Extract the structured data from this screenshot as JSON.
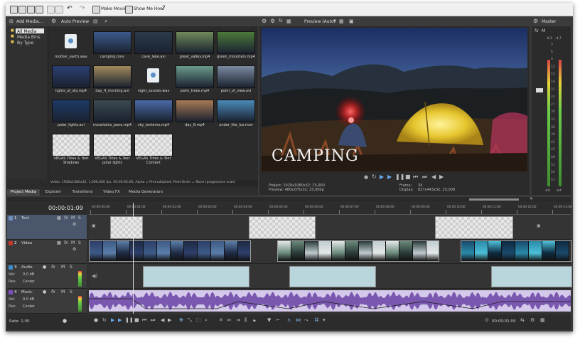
{
  "menubar": {
    "make_movie": "Make Movie",
    "show_me_how": "Show Me How"
  },
  "explorer": {
    "add_media": "Add Media...",
    "auto_preview": "Auto Preview",
    "tree": [
      "All Media",
      "Media Bins",
      "By Type"
    ],
    "items": [
      {
        "name": "mother_earth.wav",
        "kind": "audio"
      },
      {
        "name": "camping.mov",
        "kind": "video",
        "color": "#3b5a8a"
      },
      {
        "name": "cave_lake.avi",
        "kind": "video",
        "color": "#2c3b4a"
      },
      {
        "name": "great_valley.mp4",
        "kind": "video",
        "color": "#6f8a5a"
      },
      {
        "name": "green_mountain.mp4",
        "kind": "video",
        "color": "#4c7a3a"
      },
      {
        "name": "lights_of_sky.mp4",
        "kind": "video",
        "color": "#2a3f72"
      },
      {
        "name": "day_4_morning.avi",
        "kind": "video",
        "color": "#a08a5c"
      },
      {
        "name": "night_sounds.wav",
        "kind": "audio"
      },
      {
        "name": "palm_trees.mp4",
        "kind": "video",
        "color": "#6a9a8a"
      },
      {
        "name": "point_of_view.avi",
        "kind": "video",
        "color": "#7a8aa0"
      },
      {
        "name": "polar_lights.avi",
        "kind": "video",
        "color": "#1d3a66"
      },
      {
        "name": "mountains_pano.mp4",
        "kind": "video",
        "color": "#3c4a52"
      },
      {
        "name": "sky_lanterns.mp4",
        "kind": "video",
        "color": "#4a6aa8"
      },
      {
        "name": "day_6.mp4",
        "kind": "video",
        "color": "#a87a55"
      },
      {
        "name": "under_the_ice.mov",
        "kind": "video",
        "color": "#4a8ab8"
      },
      {
        "name": "VEGAS Titles & Text Shadows",
        "kind": "title"
      },
      {
        "name": "VEGAS Titles & Text polar lights",
        "kind": "title"
      },
      {
        "name": "VEGAS Titles & Text Content",
        "kind": "title"
      }
    ],
    "status": "Video: 1920x1080x32; 1,000,000 fps; 00:00:05:00; Alpha = Premultiplied; Field Order = None (progressive scan)",
    "tabs": [
      "Project Media",
      "Explorer",
      "Transitions",
      "Video FX",
      "Media Generators"
    ]
  },
  "preview": {
    "quality": "Preview (Auto)",
    "overlay_title": "CAMPING",
    "project": "Project:  1920x1080x32; 25,000",
    "preview_res": "Preview:  480x270x32; 25,000p",
    "frame_label": "Frame:",
    "frame_value": "34",
    "display_label": "Display:",
    "display_value": "827x443x32; 25,000"
  },
  "master": {
    "title": "Master",
    "scale": [
      "-4,3",
      "-4,7"
    ],
    "db_ticks": [
      "3",
      "6",
      "9",
      "12",
      "15",
      "18",
      "21",
      "24",
      "27",
      "30",
      "33",
      "36",
      "39",
      "42",
      "45",
      "48",
      "51",
      "54",
      "57"
    ],
    "bottom": [
      "-Inf.",
      "-Inf."
    ]
  },
  "timeline": {
    "timecode": "00:00:01:09",
    "ruler": [
      "00:00:00:00",
      "00:00:01:00",
      "00:00:02:00",
      "00:00:03:00",
      "00:00:04:00",
      "00:00:05:00",
      "00:00:06:00",
      "00:00:07:00",
      "00:00:08:00",
      "00:00:09:00",
      "00:00:10:00",
      "00:00:11:00",
      "00:00:12:00",
      "00:00:13:00"
    ],
    "tracks": [
      {
        "num": "1",
        "name": "Text",
        "color": "#6f8fbf"
      },
      {
        "num": "2",
        "name": "Video",
        "color": "#c0392b"
      },
      {
        "num": "3",
        "name": "Audio",
        "color": "#3a8fd0",
        "vol_label": "Vol:",
        "vol": "0,0 dB",
        "pan_label": "Pan:",
        "pan": "Center"
      },
      {
        "num": "4",
        "name": "Music",
        "color": "#7a4fc0",
        "vol_label": "Vol:",
        "vol": "0,0 dB",
        "pan_label": "Pan:",
        "pan": "Center"
      }
    ],
    "rate": "Rate: 1,00",
    "end_timecode": "00:00:01:09"
  }
}
